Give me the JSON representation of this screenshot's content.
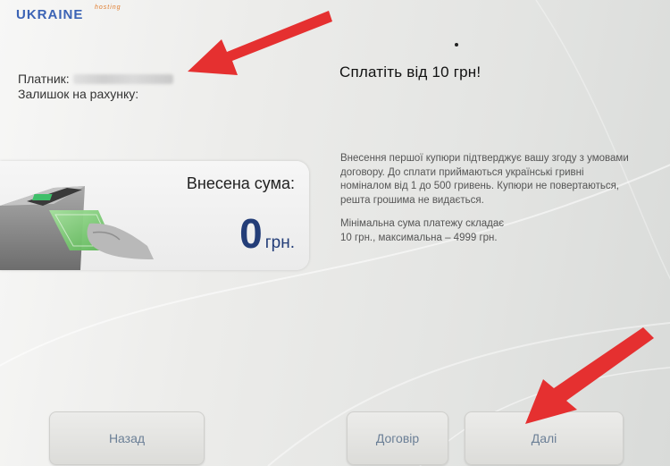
{
  "logo": {
    "text": "UKRAINE",
    "sub": "hosting"
  },
  "payer": {
    "payer_label": "Платник:",
    "balance_label": "Залишок на рахунку:"
  },
  "pay_title": "Сплатіть від 10 грн!",
  "deposit": {
    "label": "Внесена сума:",
    "amount": "0",
    "unit": "грн."
  },
  "info": {
    "paragraph1": "Внесення першої купюри підтверджує вашу згоду з умовами договору. До сплати приймаються українські гривні номіналом від 1 до 500 гривень. Купюри не повертаються, решта грошима не видається.",
    "paragraph2_line1": "Мінімальна сума платежу складає",
    "paragraph2_line2": "10 грн., максимальна – 4999 грн."
  },
  "buttons": {
    "back": "Назад",
    "contract": "Договір",
    "next": "Далі"
  },
  "colors": {
    "amount": "#233d78",
    "button_text": "#6b7f96",
    "annotation_arrow": "#e53030"
  }
}
